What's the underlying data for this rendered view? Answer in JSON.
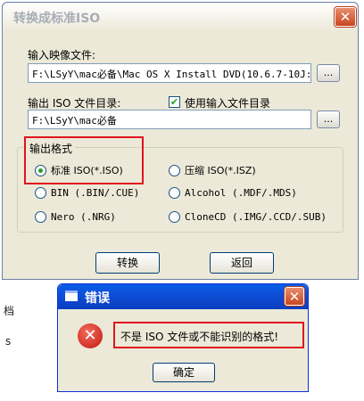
{
  "main_dialog": {
    "title": "转换成标准ISO",
    "close_glyph": "✕",
    "input_image_label": "输入映像文件:",
    "input_image_value": "F:\\LSyY\\mac必备\\Mac OS X Install DVD(10.6.7-10J:",
    "browse_label": "...",
    "output_dir_label": "输出 ISO 文件目录:",
    "use_input_dir_label": "使用输入文件目录",
    "use_input_dir_checked": "✔",
    "output_dir_value": "F:\\LSyY\\mac必备",
    "format_group_label": "输出格式",
    "formats": [
      "标准 ISO(*.ISO)",
      "压缩 ISO(*.ISZ)",
      "BIN (.BIN/.CUE)",
      "Alcohol (.MDF/.MDS)",
      "Nero (.NRG)",
      "CloneCD (.IMG/.CCD/.SUB)"
    ],
    "convert_button": "转换",
    "back_button": "返回"
  },
  "background": {
    "fragment1": "档",
    "fragment2": "s"
  },
  "error_dialog": {
    "title": "错误",
    "close_glyph": "✕",
    "icon_glyph": "✕",
    "message": "不是 ISO 文件或不能识别的格式!",
    "ok_button": "确定"
  },
  "colors": {
    "highlight_border": "#e0141e",
    "xp_title_blue": "#0a4fd4",
    "dialog_face": "#ece9d8"
  }
}
